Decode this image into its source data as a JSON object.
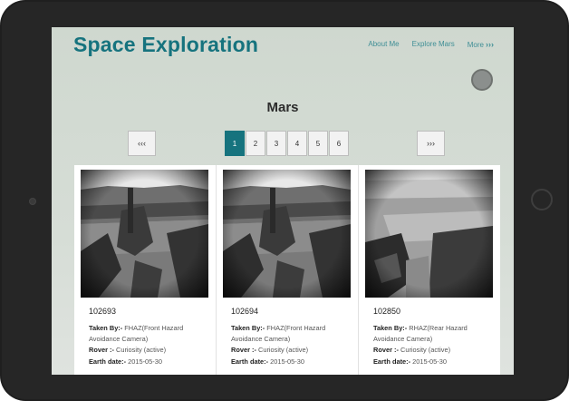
{
  "site": {
    "title": "Space Exploration",
    "nav": [
      {
        "label": "About Me"
      },
      {
        "label": "Explore Mars"
      },
      {
        "label": "More",
        "arrow": "›››"
      }
    ]
  },
  "heading": "Mars",
  "pagination": {
    "prev": "‹‹‹",
    "next": "›››",
    "pages": [
      "1",
      "2",
      "3",
      "4",
      "5",
      "6"
    ],
    "active_page": "1"
  },
  "labels": {
    "taken_by": "Taken By:-",
    "rover": "Rover :-",
    "earth_date": "Earth date:-"
  },
  "photos": [
    {
      "id": "102693",
      "camera": "FHAZ(Front Hazard Avoidance Camera)",
      "rover": "Curiosity (active)",
      "earth_date": "2015-05-30"
    },
    {
      "id": "102694",
      "camera": "FHAZ(Front Hazard Avoidance Camera)",
      "rover": "Curiosity (active)",
      "earth_date": "2015-05-30"
    },
    {
      "id": "102850",
      "camera": "RHAZ(Rear Hazard Avoidance Camera)",
      "rover": "Curiosity (active)",
      "earth_date": "2015-05-30"
    }
  ]
}
